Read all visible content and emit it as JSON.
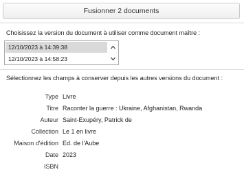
{
  "dialog": {
    "merge_button_label": "Fusionner 2 documents"
  },
  "master": {
    "prompt": "Choisissez la version du document à utiliser comme document maître :",
    "versions": [
      "12/10/2023 à 14:39:38",
      "12/10/2023 à 14:58:23"
    ],
    "selected_index": 0
  },
  "fields_section": {
    "prompt": "Sélectionnez les champs à conserver depuis les autres versions du document :",
    "fields": [
      {
        "label": "Type",
        "value": "Livre"
      },
      {
        "label": "Titre",
        "value": "Raconter la guerre : Ukraine, Afghanistan, Rwanda"
      },
      {
        "label": "Auteur",
        "value": "Saint-Exupéry, Patrick de"
      },
      {
        "label": "Collection",
        "value": "Le 1 en livre"
      },
      {
        "label": "Maison d'édition",
        "value": "Ed. de l'Aube"
      },
      {
        "label": "Date",
        "value": "2023"
      },
      {
        "label": "ISBN",
        "value": ""
      }
    ]
  },
  "icons": {
    "scroll_up": "chevron-up-icon",
    "scroll_down": "chevron-down-icon"
  }
}
